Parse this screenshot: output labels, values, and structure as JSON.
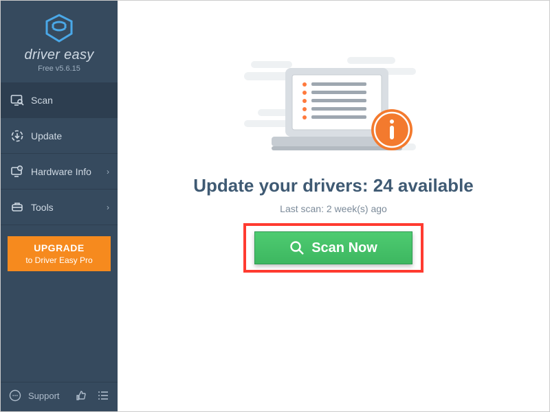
{
  "brand": {
    "name": "driver easy",
    "version": "Free v5.6.15"
  },
  "nav": {
    "scan": {
      "label": "Scan"
    },
    "update": {
      "label": "Update"
    },
    "hw": {
      "label": "Hardware Info"
    },
    "tools": {
      "label": "Tools"
    }
  },
  "upgrade": {
    "line1": "UPGRADE",
    "line2": "to Driver Easy Pro"
  },
  "support": {
    "label": "Support"
  },
  "main": {
    "headline_prefix": "Update your drivers: ",
    "available_count": "24",
    "headline_suffix": " available",
    "last_scan": "Last scan: 2 week(s) ago",
    "scan_now": "Scan Now"
  },
  "colors": {
    "accent": "#f68a1e",
    "scan_green": "#3db760",
    "highlight_red": "#ff3b30"
  }
}
